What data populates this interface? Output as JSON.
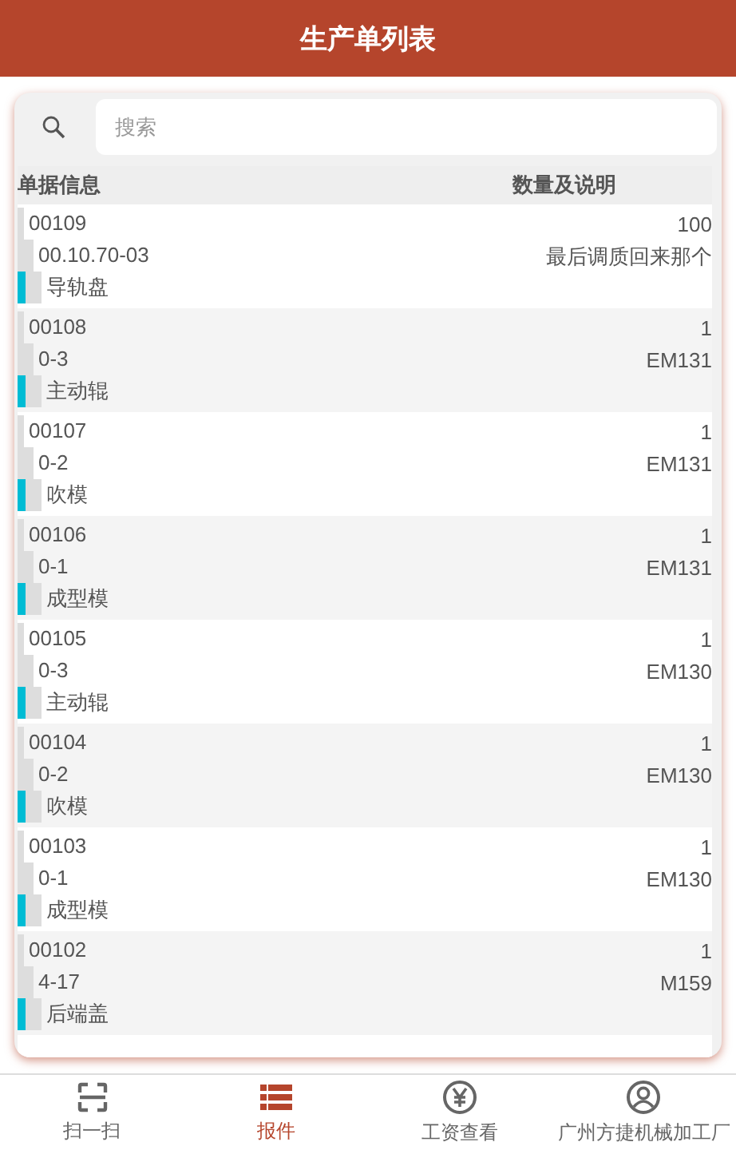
{
  "header": {
    "title": "生产单列表"
  },
  "search": {
    "placeholder": "搜索"
  },
  "table": {
    "columns": [
      "单据信息",
      "数量及说明"
    ],
    "rows": [
      {
        "number": "00109",
        "code": "00.10.70-03",
        "part": "导轨盘",
        "quantity": "100",
        "note": "最后调质回来那个"
      },
      {
        "number": "00108",
        "code": "0-3",
        "part": "主动辊",
        "quantity": "1",
        "note": "EM131"
      },
      {
        "number": "00107",
        "code": "0-2",
        "part": "吹模",
        "quantity": "1",
        "note": "EM131"
      },
      {
        "number": "00106",
        "code": "0-1",
        "part": "成型模",
        "quantity": "1",
        "note": "EM131"
      },
      {
        "number": "00105",
        "code": "0-3",
        "part": "主动辊",
        "quantity": "1",
        "note": "EM130"
      },
      {
        "number": "00104",
        "code": "0-2",
        "part": "吹模",
        "quantity": "1",
        "note": "EM130"
      },
      {
        "number": "00103",
        "code": "0-1",
        "part": "成型模",
        "quantity": "1",
        "note": "EM130"
      },
      {
        "number": "00102",
        "code": "4-17",
        "part": "后端盖",
        "quantity": "1",
        "note": "M159"
      }
    ]
  },
  "tabbar": [
    {
      "label": "扫一扫",
      "kind": "scan",
      "selected": false
    },
    {
      "label": "报件",
      "kind": "list",
      "selected": true
    },
    {
      "label": "工资查看",
      "kind": "wage",
      "selected": false
    },
    {
      "label": "广州方捷机械加工厂",
      "kind": "profile",
      "selected": false
    }
  ]
}
